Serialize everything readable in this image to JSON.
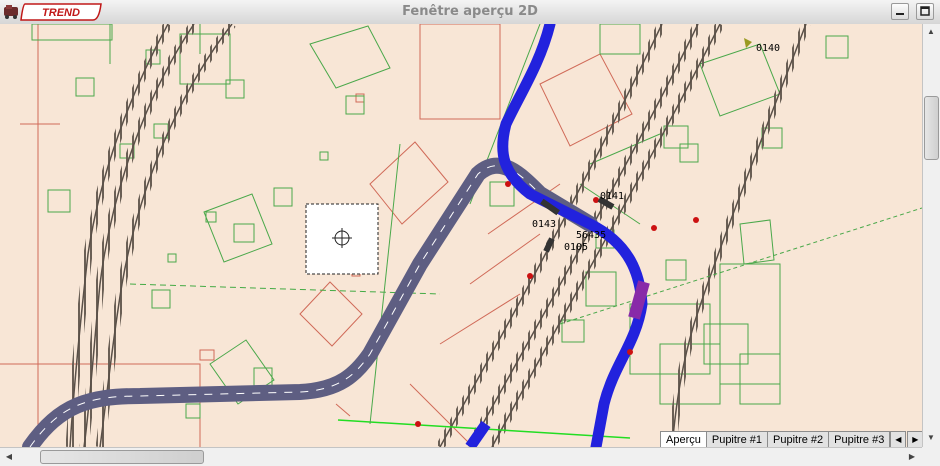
{
  "window": {
    "title": "Fenêtre aperçu 2D",
    "logo_text": "TREND"
  },
  "map": {
    "labels": {
      "signal_1": "0140",
      "signal_2": "0141",
      "signal_3": "0143",
      "signal_4": "56435",
      "signal_5": "0105"
    }
  },
  "tabs": [
    "Aperçu",
    "Pupitre #1",
    "Pupitre #2",
    "Pupitre #3"
  ],
  "colors": {
    "background": "#f8e6d6",
    "road": "#5e5e82",
    "blue_route": "#2222dd",
    "track": "#6a5f55",
    "building_green": "#4aa84a",
    "building_red": "#d06a58"
  }
}
